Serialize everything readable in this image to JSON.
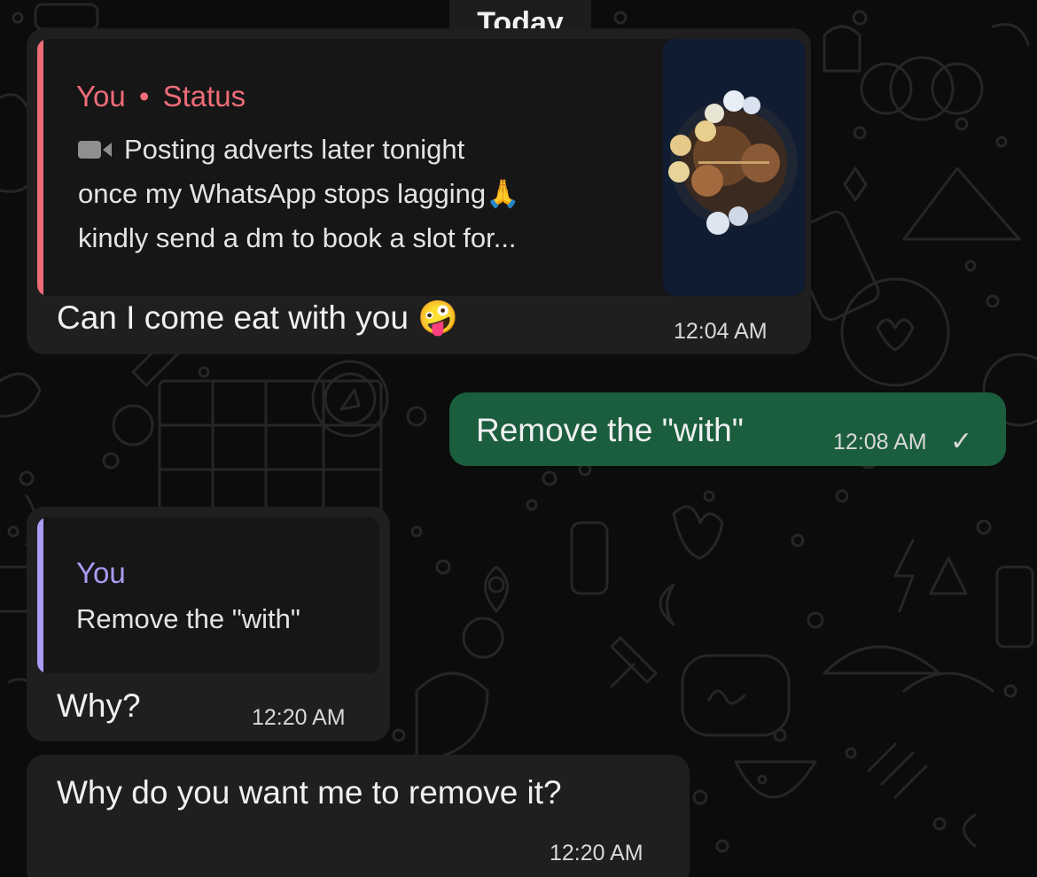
{
  "day_separator": "Today",
  "messages": [
    {
      "direction": "incoming",
      "reply": {
        "author": "You",
        "separator": "•",
        "context": "Status",
        "media_icon": "video-camera-icon",
        "lines": [
          "Posting adverts later tonight",
          "once my WhatsApp stops lagging🙏",
          "kindly send a dm to book a slot for..."
        ],
        "thumbnail": "food-platter-thumbnail"
      },
      "text": "Can I come eat with you 🤪",
      "time": "12:04 AM"
    },
    {
      "direction": "outgoing",
      "text": "Remove the \"with\"",
      "time": "12:08 AM",
      "status_icon": "single-check-icon",
      "status_glyph": "✓"
    },
    {
      "direction": "incoming",
      "reply": {
        "author": "You",
        "text": "Remove the \"with\""
      },
      "text": "Why?",
      "time": "12:20 AM"
    },
    {
      "direction": "incoming",
      "text": "Why do you want me to remove it?",
      "time": "12:20 AM"
    }
  ],
  "colors": {
    "incoming_bubble": "#1f1f1f",
    "outgoing_bubble": "#1b5e3e",
    "status_reply_accent": "#ee6c78",
    "self_reply_accent": "#a99cf5"
  }
}
